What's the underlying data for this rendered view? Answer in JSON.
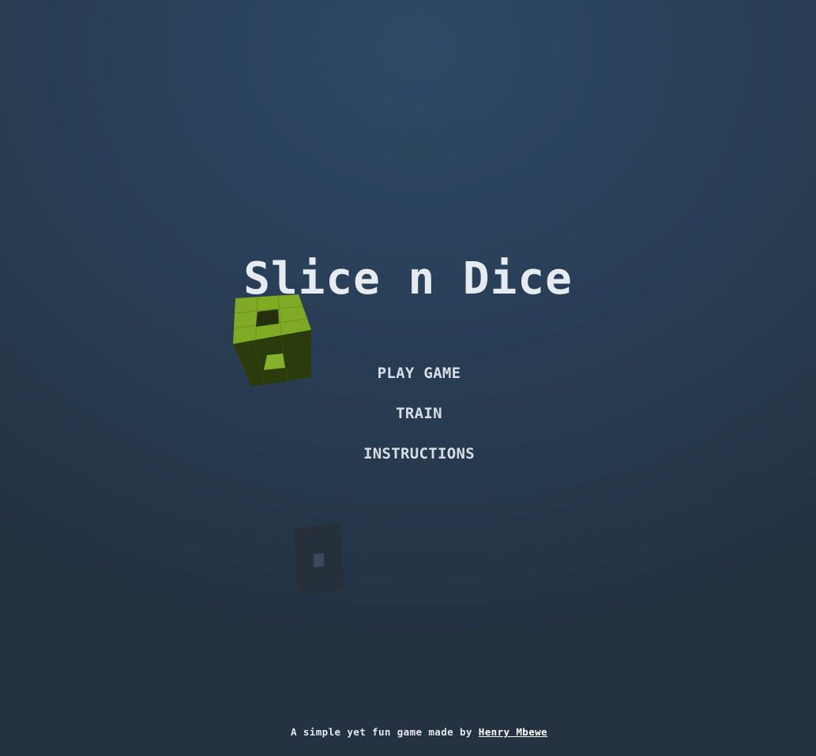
{
  "game": {
    "title": "Slice n Dice"
  },
  "menu": {
    "items": [
      {
        "label": "PLAY GAME"
      },
      {
        "label": "TRAIN"
      },
      {
        "label": "INSTRUCTIONS"
      }
    ]
  },
  "footer": {
    "text": "A simple yet fun game made by ",
    "author": "Henry Mbewe"
  },
  "colors": {
    "background_top": "#2e4a66",
    "background_bottom": "#243242",
    "cube_light": "#7faa24",
    "cube_dark": "#2c3b0c",
    "slice": "#26303b",
    "text": "#e6ebf1"
  },
  "icons": {
    "cube": "green-voxel-cube-icon",
    "slice": "dark-slice-piece-icon"
  }
}
